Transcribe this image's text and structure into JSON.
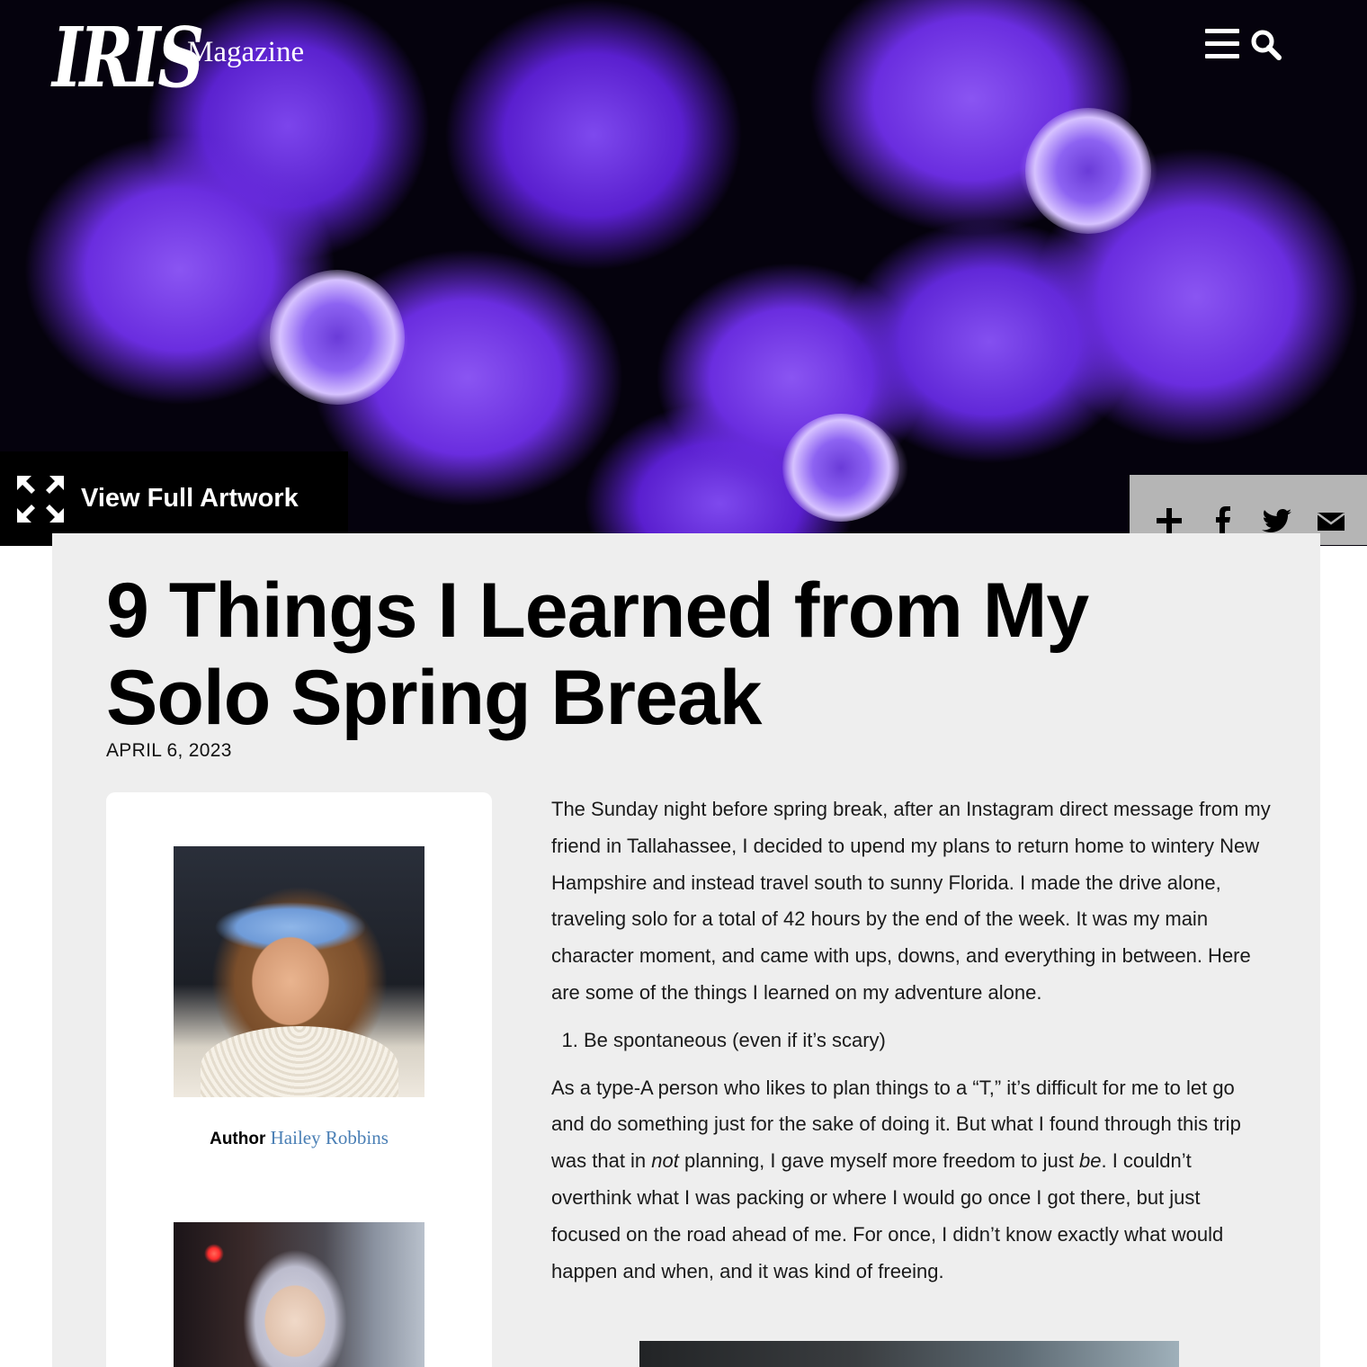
{
  "header": {
    "logo": "IRIS",
    "subtitle": "Magazine",
    "icons": [
      "menu-icon",
      "search-icon"
    ]
  },
  "hero": {
    "view_artwork_label": "View Full Artwork"
  },
  "share": {
    "icons": [
      "plus-icon",
      "facebook-icon",
      "twitter-icon",
      "mail-icon"
    ]
  },
  "article": {
    "title": "9 Things I Learned from My Solo Spring Break",
    "date": "APRIL 6, 2023",
    "author_label": "Author",
    "author_name": "Hailey Robbins",
    "intro": "The Sunday night before spring break, after an Instagram direct message from my friend in Tallahassee, I decided to upend my plans to return home to wintery New Hampshire and instead travel south to sunny Florida. I made the drive alone, traveling solo for a total of 42 hours by the end of the week. It was my main character moment, and came with ups, downs, and everything in between. Here are some of the things I learned on my adventure alone.",
    "list_item_1": "Be spontaneous (even if it’s scary)",
    "para2_part1": "As a type-A person who likes to plan things to a “T,” it’s difficult for me to let go and do something just for the sake of doing it. But what I found through this trip was that in ",
    "para2_em1": "not",
    "para2_part2": " planning, I gave myself more freedom to just ",
    "para2_em2": "be",
    "para2_part3": ". I couldn’t overthink what I was packing or where I would go once I got there, but just focused on the road ahead of me. For once, I didn’t know exactly what would happen and when, and it was kind of freeing."
  },
  "colors": {
    "hero_purple": "#6a2ddf",
    "card_bg": "#eeeeee",
    "share_bar": "#b5b5b5",
    "author_link": "#4a7fb5"
  }
}
